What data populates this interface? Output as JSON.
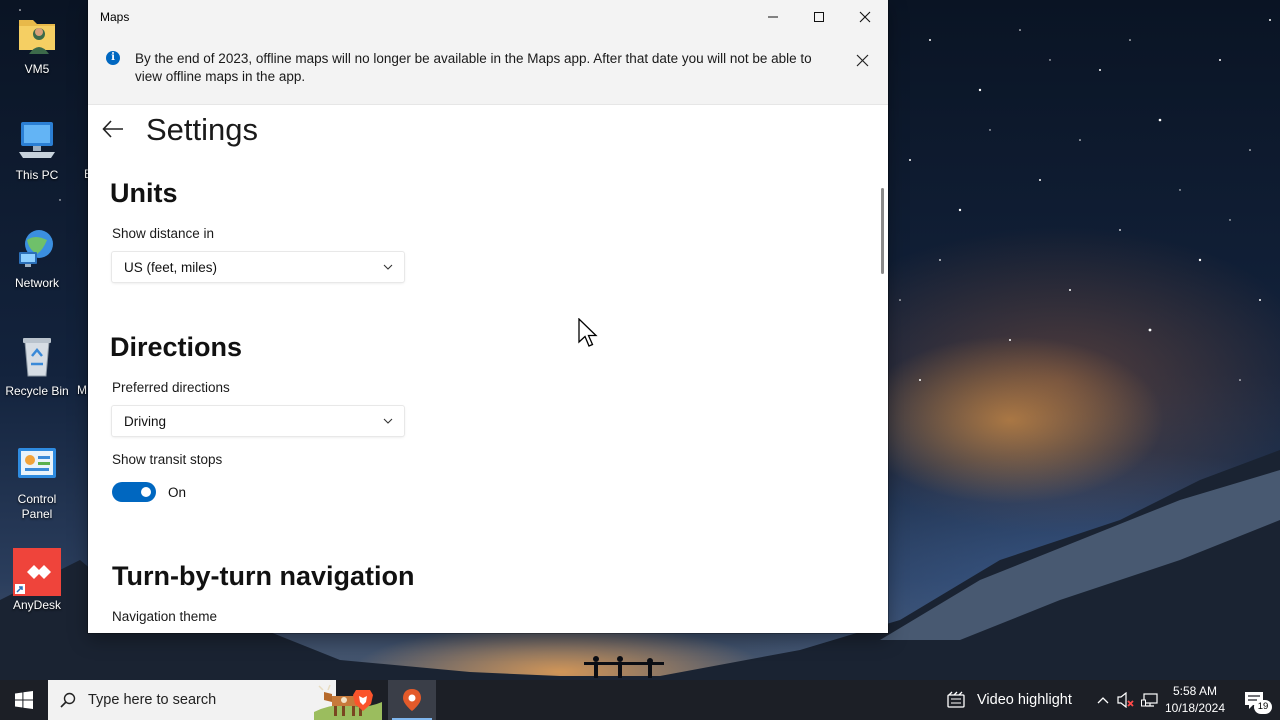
{
  "window": {
    "title": "Maps",
    "infobar_text": "By the end of 2023, offline maps will no longer be available in the Maps app. After that date you will not be able to view offline maps in the app."
  },
  "settings": {
    "title": "Settings",
    "units": {
      "heading": "Units",
      "distance_label": "Show distance in",
      "distance_value": "US (feet, miles)"
    },
    "directions": {
      "heading": "Directions",
      "preferred_label": "Preferred directions",
      "preferred_value": "Driving",
      "transit_label": "Show transit stops",
      "transit_state": "On",
      "transit_on": true
    },
    "navigation": {
      "heading": "Turn-by-turn navigation",
      "theme_label": "Navigation theme"
    }
  },
  "desktop": {
    "icons": [
      {
        "label": "VM5"
      },
      {
        "label": "This PC"
      },
      {
        "label": "Network"
      },
      {
        "label": "Recycle Bin"
      },
      {
        "label": "Control Panel"
      },
      {
        "label": "AnyDesk"
      }
    ],
    "clipped_labels": [
      "E",
      "M"
    ]
  },
  "taskbar": {
    "search_placeholder": "Type here to search",
    "video_highlight": "Video highlight",
    "time": "5:58 AM",
    "date": "10/18/2024",
    "notification_count": "19"
  },
  "colors": {
    "accent": "#0067c0",
    "taskbar": "#1c1f26",
    "infobar": "#f3f3f3"
  }
}
